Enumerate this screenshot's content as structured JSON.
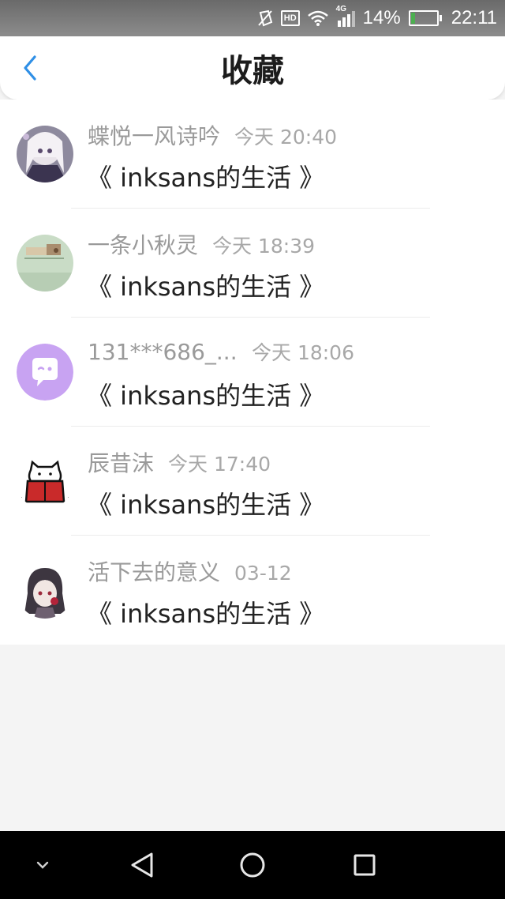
{
  "status_bar": {
    "network": "4G",
    "hd": "HD",
    "battery": "14%",
    "time": "22:11",
    "battery_color": "#4caf50"
  },
  "header": {
    "title": "收藏"
  },
  "items": [
    {
      "name": "蝶悦一风诗吟",
      "time": "今天 20:40",
      "title": "《 inksans的生活 》"
    },
    {
      "name": "一条小秋灵",
      "time": "今天 18:39",
      "title": "《 inksans的生活 》"
    },
    {
      "name": "131***686_...",
      "time": "今天 18:06",
      "title": "《 inksans的生活 》"
    },
    {
      "name": "辰昔沫",
      "time": "今天 17:40",
      "title": "《 inksans的生活 》"
    },
    {
      "name": "活下去的意义",
      "time": "03-12",
      "title": "《 inksans的生活 》"
    }
  ],
  "colors": {
    "accent": "#2f8fe6",
    "avatar_purple": "#c8a3f2"
  }
}
